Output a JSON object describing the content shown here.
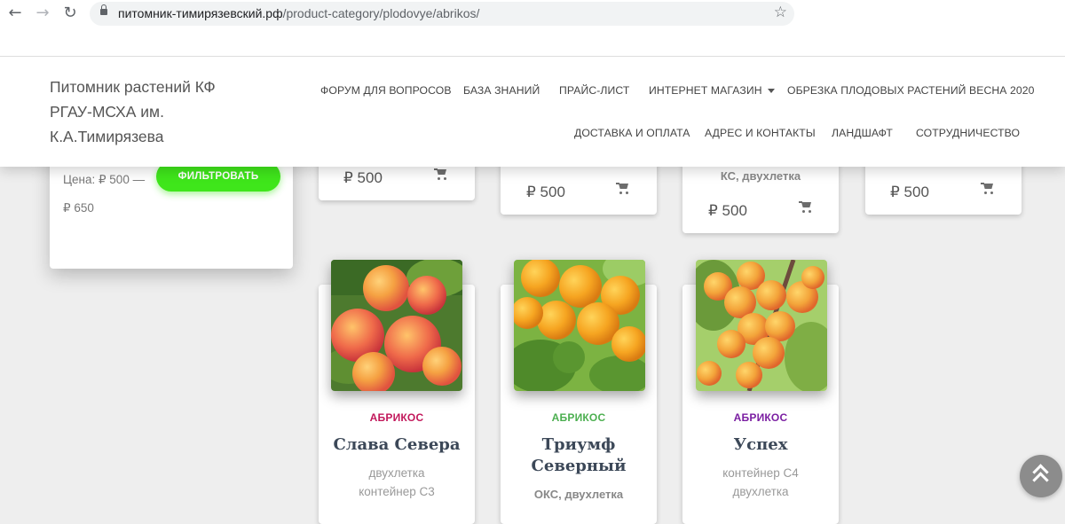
{
  "browser": {
    "back_icon": "←",
    "forward_icon": "→",
    "reload_icon": "↻",
    "url_host": "питомник-тимирязевский.рф",
    "url_path": "/product-category/plodovye/abrikos/",
    "star_icon": "☆"
  },
  "header": {
    "brand_line1": "Питомник растений КФ",
    "brand_line2": "РГАУ-МСХА им.",
    "brand_line3": "К.А.Тимирязева",
    "menu": [
      {
        "label": "ФОРУМ ДЛЯ ВОПРОСОВ"
      },
      {
        "label": "БАЗА ЗНАНИЙ"
      },
      {
        "label": "ПРАЙС-ЛИСТ"
      },
      {
        "label": "ИНТЕРНЕТ МАГАЗИН"
      },
      {
        "label": "ОБРЕЗКА ПЛОДОВЫХ РАСТЕНИЙ ВЕСНА 2020"
      },
      {
        "label": "ДОСТАВКА И ОПЛАТА"
      },
      {
        "label": "АДРЕС И КОНТАКТЫ"
      },
      {
        "label": "ЛАНДШАФТ"
      },
      {
        "label": "СОТРУДНИЧЕСТВО"
      }
    ]
  },
  "filter": {
    "price_text": "Цена: ₽ 500 — ₽ 650",
    "button_label": "ФИЛЬТРОВАТЬ",
    "button_color": "#3fe61b"
  },
  "top_cards": [
    {
      "price": "₽ 500"
    },
    {
      "price": "₽ 500"
    },
    {
      "subtitle": "КС, двухлетка",
      "price": "₽ 500"
    },
    {
      "price": "₽ 500"
    }
  ],
  "products": [
    {
      "category": "АБРИКОС",
      "category_color": "#c2185b",
      "title": "Слава Севера",
      "desc1": "двухлетка",
      "desc2": "контейнер С3"
    },
    {
      "category": "АБРИКОС",
      "category_color": "#4caf50",
      "title": "Триумф Северный",
      "desc_bold": "ОКС, двухлетка"
    },
    {
      "category": "АБРИКОС",
      "category_color": "#7b1fa2",
      "title": "Успех",
      "desc1": "контейнер С4",
      "desc2": "двухлетка"
    }
  ]
}
